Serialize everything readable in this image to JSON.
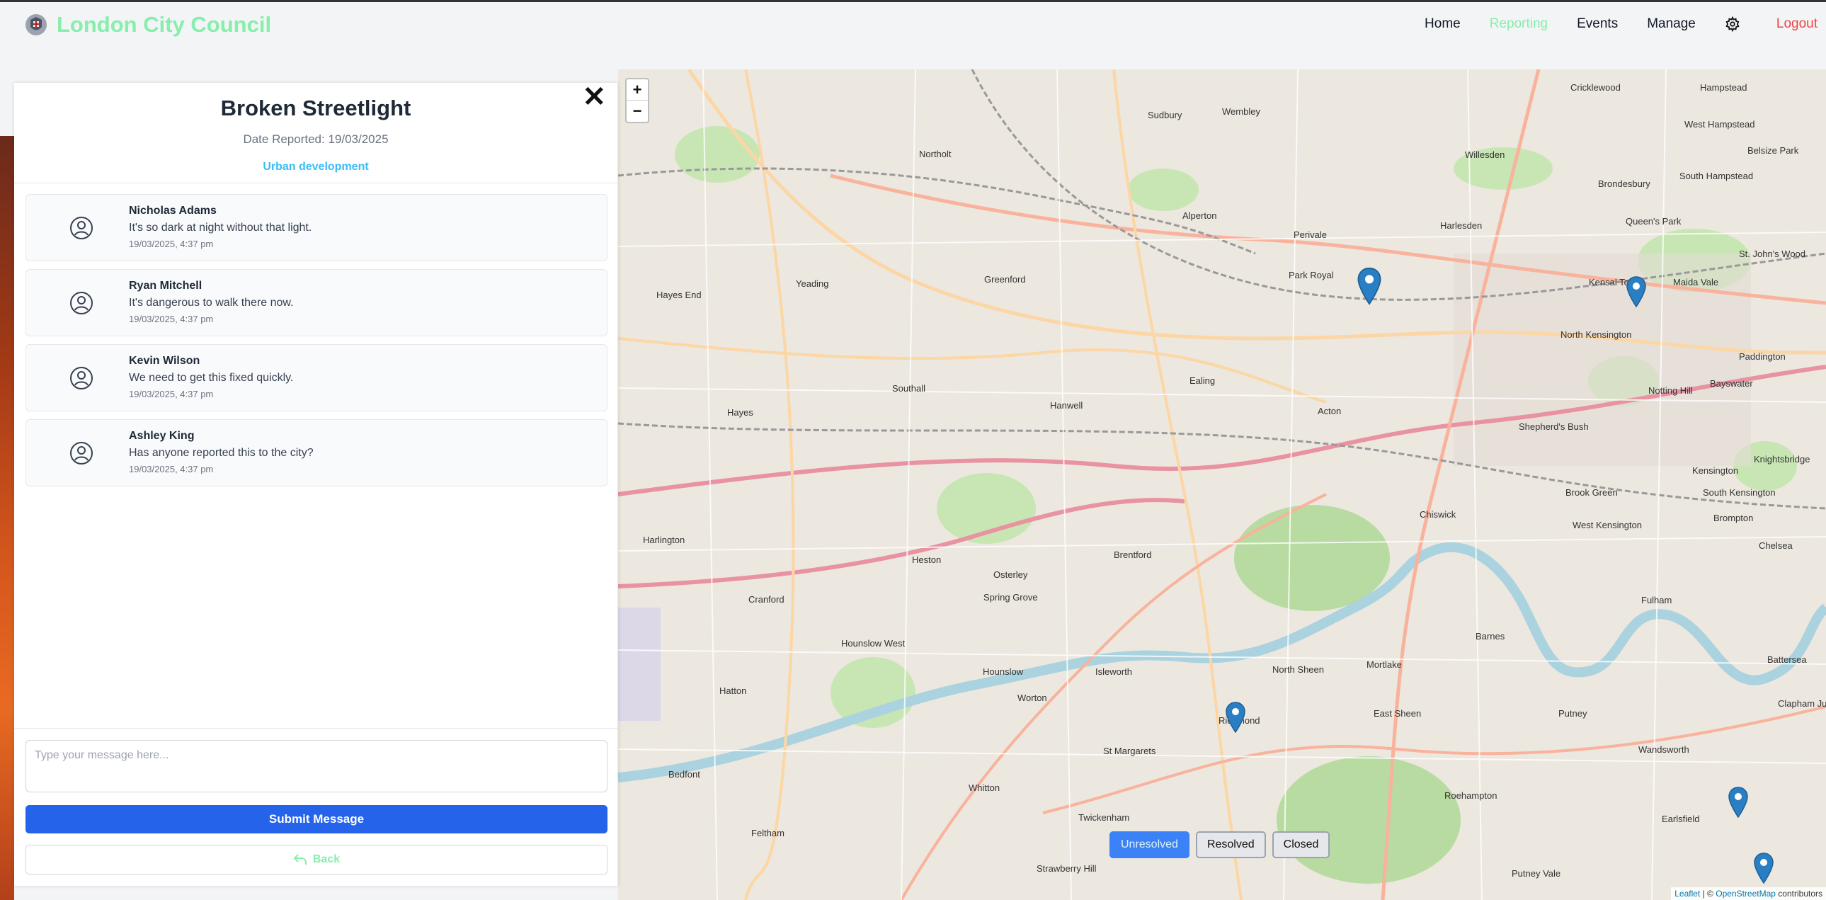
{
  "header": {
    "brand_title": "London City Council",
    "nav": {
      "home": "Home",
      "reporting": "Reporting",
      "events": "Events",
      "manage": "Manage",
      "logout": "Logout"
    },
    "accent_color": "#86efac",
    "logout_color": "#ef4444"
  },
  "panel": {
    "title": "Broken Streetlight",
    "date_reported": "Date Reported: 19/03/2025",
    "category": "Urban development",
    "comments": [
      {
        "name": "Nicholas Adams",
        "text": "It's so dark at night without that light.",
        "time": "19/03/2025, 4:37 pm"
      },
      {
        "name": "Ryan Mitchell",
        "text": "It's dangerous to walk there now.",
        "time": "19/03/2025, 4:37 pm"
      },
      {
        "name": "Kevin Wilson",
        "text": "We need to get this fixed quickly.",
        "time": "19/03/2025, 4:37 pm"
      },
      {
        "name": "Ashley King",
        "text": "Has anyone reported this to the city?",
        "time": "19/03/2025, 4:37 pm"
      }
    ],
    "message_placeholder": "Type your message here...",
    "submit_label": "Submit Message",
    "back_label": "Back"
  },
  "map": {
    "zoom_in": "+",
    "zoom_out": "−",
    "filters": {
      "unresolved": "Unresolved",
      "resolved": "Resolved",
      "closed": "Closed"
    },
    "attribution_leaflet": "Leaflet",
    "attribution_osm": "OpenStreetMap",
    "attribution_prefix": "| ©",
    "attribution_suffix": "contributors",
    "places": [
      "Cricklewood",
      "Hampstead",
      "West Hampstead",
      "Belsize Park",
      "Wembley",
      "Sudbury",
      "Northolt",
      "Willesden",
      "Brondesbury",
      "South Hampstead",
      "Queen's Park",
      "St. John's Wood",
      "Harlesden",
      "Kensal Town",
      "Maida Vale",
      "Alperton",
      "Perivale",
      "Park Royal",
      "Greenford",
      "Yeading",
      "Hayes End",
      "North Kensington",
      "Paddington",
      "Notting Hill",
      "Bayswater",
      "Ealing",
      "Acton",
      "Shepherd's Bush",
      "Southall",
      "Hanwell",
      "Hayes",
      "Kensington",
      "Knightsbridge",
      "Brook Green",
      "South Kensington",
      "Chiswick",
      "West Kensington",
      "Brompton",
      "Heston",
      "Brentford",
      "Chelsea",
      "Harlington",
      "Cranford",
      "Osterley",
      "Spring Grove",
      "Fulham",
      "Barnes",
      "Battersea",
      "Hounslow West",
      "Hounslow",
      "Isleworth",
      "North Sheen",
      "Mortlake",
      "Hatton",
      "Worton",
      "East Sheen",
      "Putney",
      "Richmond",
      "Clapham Junction",
      "Bedfont",
      "St Margarets",
      "Wandsworth",
      "Whitton",
      "Roehampton",
      "Earlsfield",
      "Twickenham",
      "Feltham",
      "Strawberry Hill",
      "Putney Vale"
    ]
  }
}
